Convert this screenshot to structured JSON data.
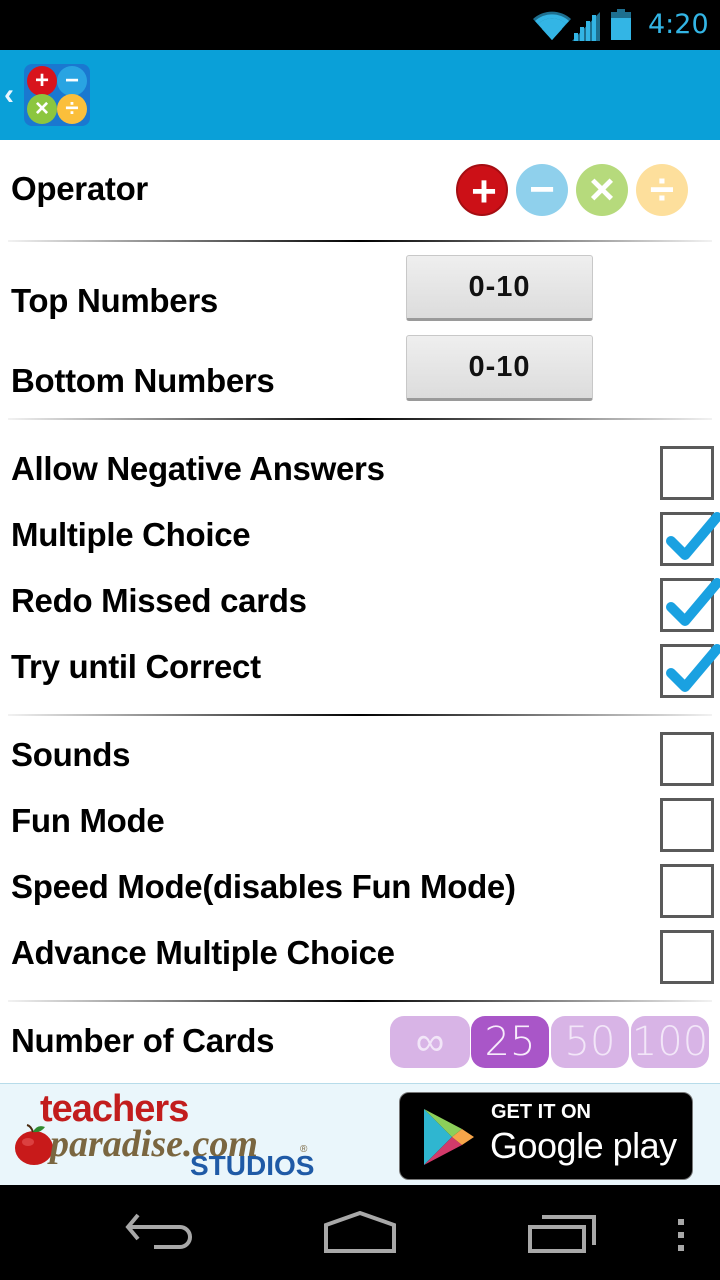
{
  "status_bar": {
    "time": "4:20",
    "icons": [
      "wifi-icon",
      "cell-signal-icon",
      "battery-icon"
    ],
    "accent_color": "#33b5e5"
  },
  "action_bar": {
    "back_glyph": "‹",
    "app_icon": [
      "plus-icon",
      "minus-icon",
      "times-icon",
      "divide-icon"
    ],
    "background_color": "#0aa0d8"
  },
  "settings": {
    "operator": {
      "label": "Operator",
      "options": [
        {
          "name": "add",
          "glyph": "+",
          "color": "#cc1017",
          "selected": true
        },
        {
          "name": "subtract",
          "glyph": "−",
          "color": "#8fd0ec",
          "selected": false
        },
        {
          "name": "multiply",
          "glyph": "×",
          "color": "#b6da7c",
          "selected": false
        },
        {
          "name": "divide",
          "glyph": "÷",
          "color": "#fddf9c",
          "selected": false
        }
      ]
    },
    "top_numbers": {
      "label": "Top Numbers",
      "value": "0-10"
    },
    "bottom_numbers": {
      "label": "Bottom Numbers",
      "value": "0-10"
    },
    "options_group_1": [
      {
        "label": "Allow Negative Answers",
        "checked": false
      },
      {
        "label": "Multiple Choice",
        "checked": true
      },
      {
        "label": "Redo Missed cards",
        "checked": true
      },
      {
        "label": "Try until Correct",
        "checked": true
      }
    ],
    "options_group_2": [
      {
        "label": "Sounds",
        "checked": false
      },
      {
        "label": "Fun Mode",
        "checked": false
      },
      {
        "label": "Speed Mode(disables Fun Mode)",
        "checked": false
      },
      {
        "label": "Advance Multiple Choice",
        "checked": false
      }
    ],
    "number_of_cards": {
      "label": "Number of Cards",
      "options": [
        {
          "label": "∞",
          "selected": false
        },
        {
          "label": "25",
          "selected": true
        },
        {
          "label": "50",
          "selected": false
        },
        {
          "label": "100",
          "selected": false
        }
      ]
    }
  },
  "ad_banner": {
    "brand_line1": "teachers",
    "brand_line2": "paradise.com",
    "brand_reg": "®",
    "brand_line3": "STUDIOS",
    "store_badge": {
      "line1": "GET IT ON",
      "line2": "Google play"
    }
  },
  "nav_bar": {
    "buttons": [
      "back-icon",
      "home-icon",
      "recent-apps-icon",
      "overflow-menu-icon"
    ]
  }
}
